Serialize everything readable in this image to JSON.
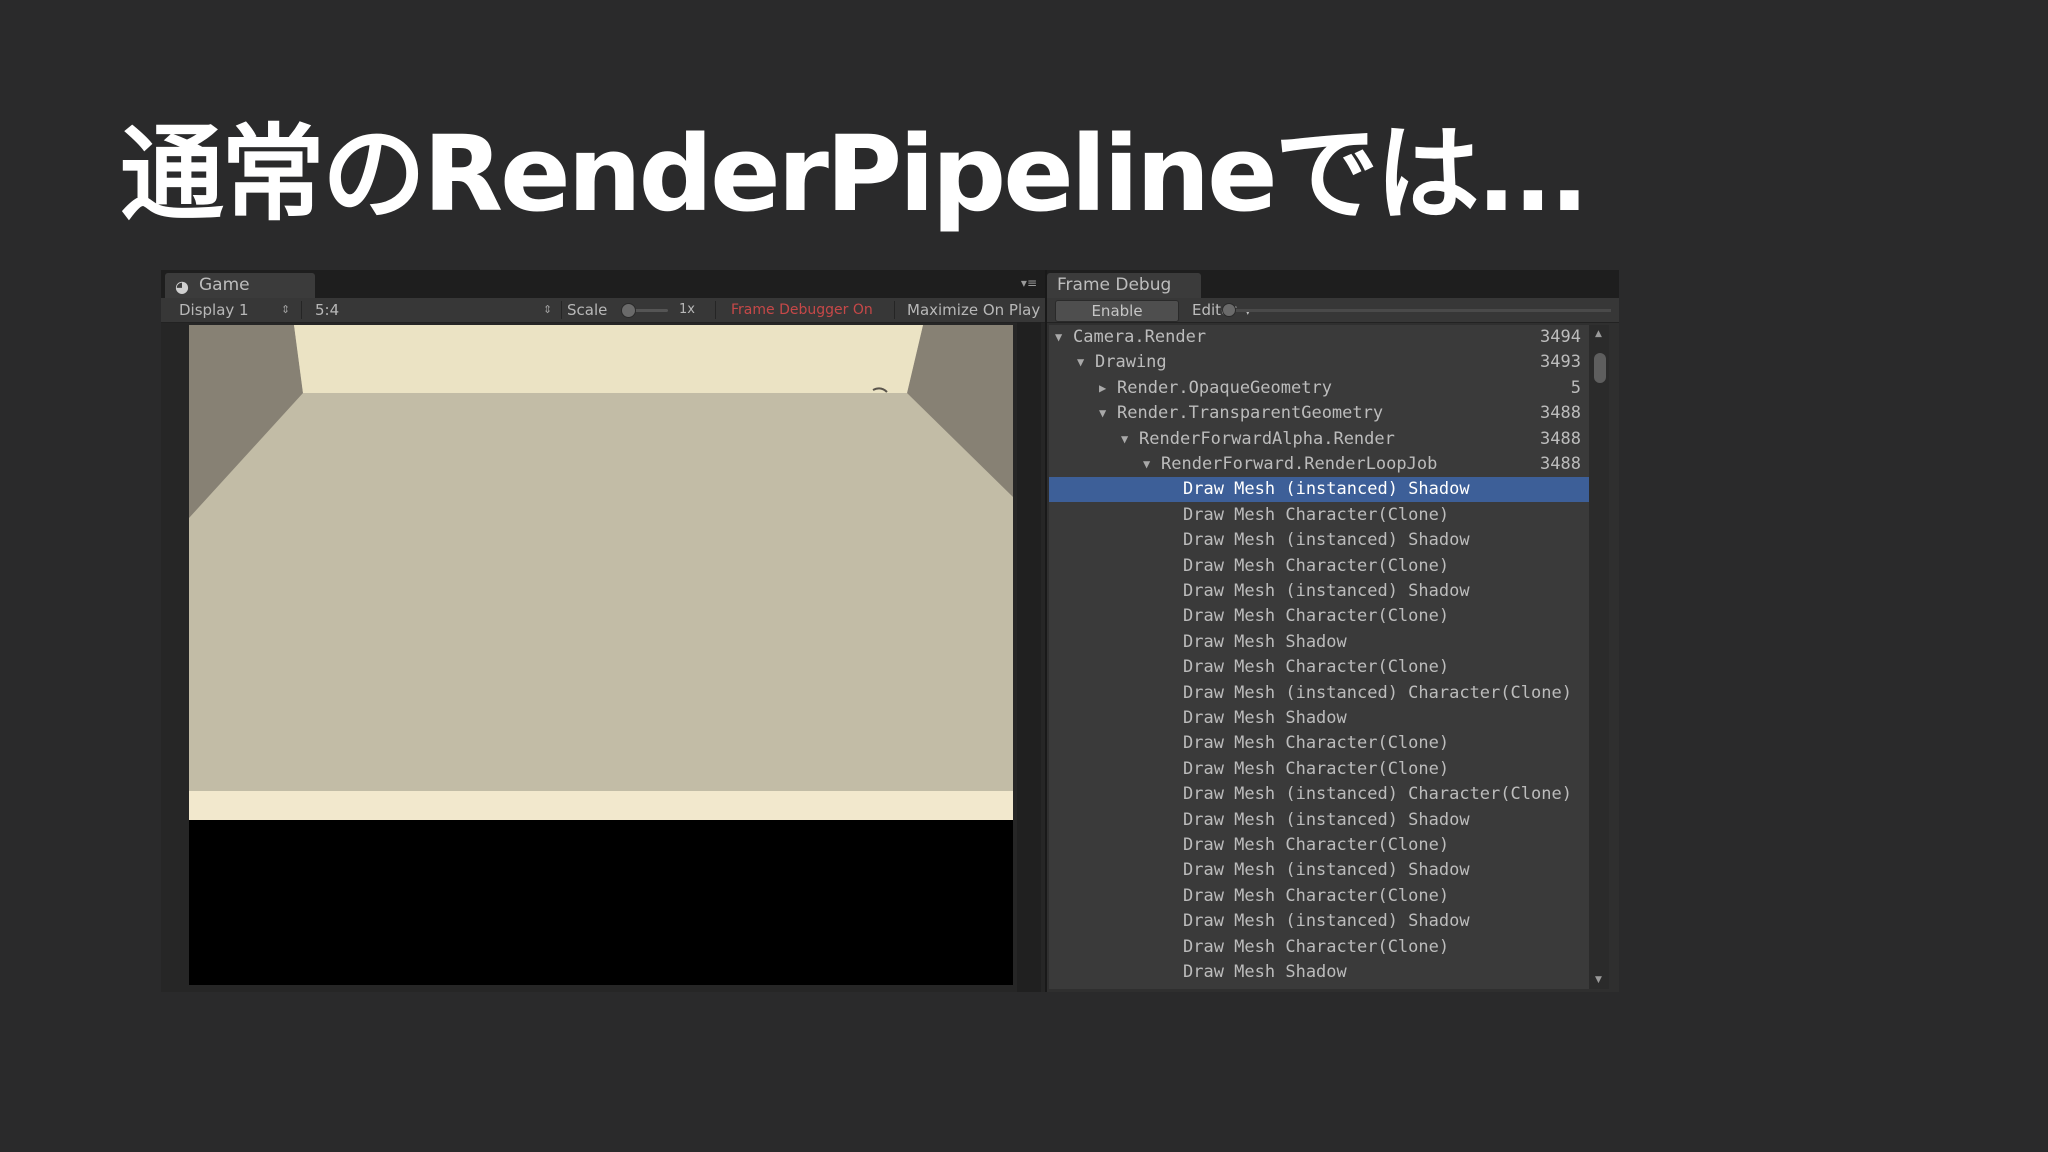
{
  "slide": {
    "title": "通常のRenderPipelineでは..."
  },
  "game": {
    "tab": {
      "icon": "pacman-icon",
      "label": "Game"
    },
    "toolbar": {
      "display": "Display 1",
      "aspect": "5:4",
      "scale_label": "Scale",
      "scale_value": "1x",
      "frame_debugger_status": "Frame Debugger On",
      "maximize": "Maximize On Play"
    },
    "colors": {
      "floor": "#c2bca6",
      "back_wall": "#ebe3c4",
      "side_wall": "#878174",
      "front_edge": "#f2e8cd",
      "frame_debugger_red": "#c64848"
    }
  },
  "frame_debugger": {
    "tab": "Frame Debug",
    "enable_button": "Enable",
    "editor_dropdown": "Editor",
    "tree": [
      {
        "label": "Camera.Render",
        "count": "3494",
        "depth": 0,
        "arrow": "expanded"
      },
      {
        "label": "Drawing",
        "count": "3493",
        "depth": 1,
        "arrow": "expanded"
      },
      {
        "label": "Render.OpaqueGeometry",
        "count": "5",
        "depth": 2,
        "arrow": "collapsed"
      },
      {
        "label": "Render.TransparentGeometry",
        "count": "3488",
        "depth": 2,
        "arrow": "expanded"
      },
      {
        "label": "RenderForwardAlpha.Render",
        "count": "3488",
        "depth": 3,
        "arrow": "expanded"
      },
      {
        "label": "RenderForward.RenderLoopJob",
        "count": "3488",
        "depth": 4,
        "arrow": "expanded"
      },
      {
        "label": "Draw Mesh (instanced) Shadow",
        "count": "",
        "depth": 5,
        "arrow": "none",
        "selected": true
      },
      {
        "label": "Draw Mesh Character(Clone)",
        "count": "",
        "depth": 5,
        "arrow": "none"
      },
      {
        "label": "Draw Mesh (instanced) Shadow",
        "count": "",
        "depth": 5,
        "arrow": "none"
      },
      {
        "label": "Draw Mesh Character(Clone)",
        "count": "",
        "depth": 5,
        "arrow": "none"
      },
      {
        "label": "Draw Mesh (instanced) Shadow",
        "count": "",
        "depth": 5,
        "arrow": "none"
      },
      {
        "label": "Draw Mesh Character(Clone)",
        "count": "",
        "depth": 5,
        "arrow": "none"
      },
      {
        "label": "Draw Mesh Shadow",
        "count": "",
        "depth": 5,
        "arrow": "none"
      },
      {
        "label": "Draw Mesh Character(Clone)",
        "count": "",
        "depth": 5,
        "arrow": "none"
      },
      {
        "label": "Draw Mesh (instanced) Character(Clone)",
        "count": "",
        "depth": 5,
        "arrow": "none"
      },
      {
        "label": "Draw Mesh Shadow",
        "count": "",
        "depth": 5,
        "arrow": "none"
      },
      {
        "label": "Draw Mesh Character(Clone)",
        "count": "",
        "depth": 5,
        "arrow": "none"
      },
      {
        "label": "Draw Mesh Character(Clone)",
        "count": "",
        "depth": 5,
        "arrow": "none"
      },
      {
        "label": "Draw Mesh (instanced) Character(Clone)",
        "count": "",
        "depth": 5,
        "arrow": "none"
      },
      {
        "label": "Draw Mesh (instanced) Shadow",
        "count": "",
        "depth": 5,
        "arrow": "none"
      },
      {
        "label": "Draw Mesh Character(Clone)",
        "count": "",
        "depth": 5,
        "arrow": "none"
      },
      {
        "label": "Draw Mesh (instanced) Shadow",
        "count": "",
        "depth": 5,
        "arrow": "none"
      },
      {
        "label": "Draw Mesh Character(Clone)",
        "count": "",
        "depth": 5,
        "arrow": "none"
      },
      {
        "label": "Draw Mesh (instanced) Shadow",
        "count": "",
        "depth": 5,
        "arrow": "none"
      },
      {
        "label": "Draw Mesh Character(Clone)",
        "count": "",
        "depth": 5,
        "arrow": "none"
      },
      {
        "label": "Draw Mesh Shadow",
        "count": "",
        "depth": 5,
        "arrow": "none"
      }
    ]
  }
}
